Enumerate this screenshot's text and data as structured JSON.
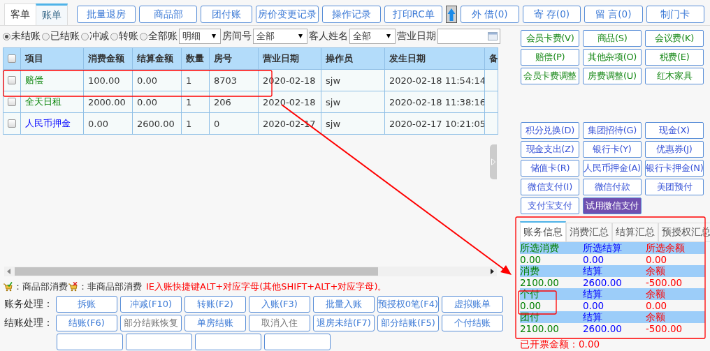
{
  "tabs": [
    {
      "label": "客单",
      "selected": false
    },
    {
      "label": "账单",
      "selected": true
    }
  ],
  "toolbar_left": [
    "批量退房",
    "商品部",
    "团付账",
    "房价变更记录",
    "操作记录",
    "打印RC单"
  ],
  "toolbar_right": [
    "外 借(0)",
    "寄 存(0)",
    "留 言(0)",
    "制门卡"
  ],
  "filters": {
    "status_options": [
      {
        "label": "未结账",
        "selected": true
      },
      {
        "label": "已结账",
        "selected": false
      },
      {
        "label": "冲减",
        "selected": false
      },
      {
        "label": "转账",
        "selected": false
      },
      {
        "label": "全部账",
        "selected": false
      }
    ],
    "view_select": "明细",
    "room_label": "房间号",
    "room_select": "全部",
    "guest_label": "客人姓名",
    "guest_select": "全部",
    "date_label": "营业日期"
  },
  "table": {
    "header_checked": false,
    "columns": [
      "项目",
      "消费金额",
      "结算金额",
      "数量",
      "房号",
      "营业日期",
      "操作员",
      "发生日期",
      "备"
    ],
    "rows": [
      {
        "checked": false,
        "kind": "charge",
        "cells": [
          "赔偿",
          "100.00",
          "0.00",
          "1",
          "8703",
          "2020-02-18",
          "sjw",
          "2020-02-18 11:54:14"
        ]
      },
      {
        "checked": false,
        "kind": "charge",
        "cells": [
          "全天日租",
          "2000.00",
          "0.00",
          "1",
          "206",
          "2020-02-18",
          "sjw",
          "2020-02-18 11:38:16"
        ]
      },
      {
        "checked": false,
        "kind": "payment",
        "cells": [
          "人民币押金",
          "0.00",
          "2600.00",
          "1",
          "0",
          "2020-02-17",
          "sjw",
          "2020-02-17 10:21:05"
        ]
      }
    ]
  },
  "charge_buttons": [
    "会员卡费(V)",
    "商品(S)",
    "会议费(K)",
    "赔偿(P)",
    "其他杂项(O)",
    "税费(E)",
    "会员卡费调整",
    "房费调整(U)",
    "红木家具"
  ],
  "payment_buttons": [
    {
      "label": "积分兑换(D)",
      "selected": false
    },
    {
      "label": "集团招待(G)",
      "selected": false
    },
    {
      "label": "现金(X)",
      "selected": false
    },
    {
      "label": "现金支出(Z)",
      "selected": false
    },
    {
      "label": "银行卡(Y)",
      "selected": false
    },
    {
      "label": "优惠券(J)",
      "selected": false
    },
    {
      "label": "储值卡(R)",
      "selected": false
    },
    {
      "label": "人民币押金(A)",
      "selected": false
    },
    {
      "label": "银行卡押金(N)",
      "selected": false
    },
    {
      "label": "微信支付(I)",
      "selected": false
    },
    {
      "label": "微信付款",
      "selected": false
    },
    {
      "label": "美团预付",
      "selected": false
    },
    {
      "label": "支付宝支付",
      "selected": false
    },
    {
      "label": "试用微信支付",
      "selected": true
    }
  ],
  "summary": {
    "tabs": [
      {
        "label": "账务信息",
        "selected": true
      },
      {
        "label": "消费汇总",
        "selected": false
      },
      {
        "label": "结算汇总",
        "selected": false
      },
      {
        "label": "预授权汇总",
        "selected": false
      }
    ],
    "sections": [
      {
        "labels": [
          "所选消费",
          "所选结算",
          "所选余额"
        ],
        "values": [
          "0.00",
          "0.00",
          "0.00"
        ]
      },
      {
        "labels": [
          "消费",
          "结算",
          "余额"
        ],
        "values": [
          "2100.00",
          "2600.00",
          "-500.00"
        ]
      },
      {
        "labels": [
          "个付",
          "结算",
          "余额"
        ],
        "values": [
          "0.00",
          "0.00",
          "0.00"
        ]
      },
      {
        "labels": [
          "团付",
          "结算",
          "余额"
        ],
        "values": [
          "2100.00",
          "2600.00",
          "-500.00"
        ]
      }
    ],
    "invoiced": "已开票金额：0.00"
  },
  "legend": {
    "goods": "：商品部消费",
    "non_goods": "：非商品部消费",
    "hint": "IE入账快捷键ALT+对应字母(其他SHIFT+ALT+对应字母)。"
  },
  "actions": [
    {
      "label": "账务处理：",
      "buttons": [
        {
          "label": "拆账",
          "disabled": false
        },
        {
          "label": "冲减(F10)",
          "disabled": false
        },
        {
          "label": "转账(F2)",
          "disabled": false
        },
        {
          "label": "入账(F3)",
          "disabled": false
        },
        {
          "label": "批量入账",
          "disabled": false
        },
        {
          "label": "预授权0笔(F4)",
          "disabled": false
        },
        {
          "label": "虚拟账单",
          "disabled": false
        }
      ]
    },
    {
      "label": "结账处理：",
      "buttons": [
        {
          "label": "结账(F6)",
          "disabled": false
        },
        {
          "label": "部分结账恢复",
          "disabled": true
        },
        {
          "label": "单房结账",
          "disabled": false
        },
        {
          "label": "取消入住",
          "disabled": true
        },
        {
          "label": "退房未结(F7)",
          "disabled": false
        },
        {
          "label": "部分结账(F5)",
          "disabled": false
        },
        {
          "label": "个付结账",
          "disabled": false
        }
      ]
    }
  ]
}
